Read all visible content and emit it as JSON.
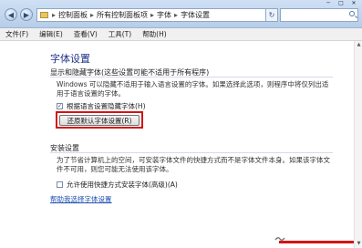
{
  "addressbar": {
    "segments": [
      "控制面板",
      "所有控制面板项",
      "字体",
      "字体设置"
    ],
    "sep": "▸"
  },
  "menubar": {
    "items": [
      "文件(F)",
      "编辑(E)",
      "查看(V)",
      "工具(T)",
      "帮助(H)"
    ]
  },
  "page": {
    "title": "字体设置",
    "section1_heading": "显示和隐藏字体(这些设置可能不适用于所有程序)",
    "section1_desc": "Windows 可以隐藏不适用于输入语言设置的字体。如果选择此选项，则程序中将仅列出适用于语言设置的字体。",
    "hide_fonts_checkbox_label": "根据语言设置隐藏字体(H)",
    "hide_fonts_checked": true,
    "restore_button_label": "还原默认字体设置(R)",
    "section2_heading": "安装设置",
    "section2_desc": "为了节省计算机上的空间，可安装字体文件的快捷方式而不是字体文件本身。如果该字体文件不可用，则您可能无法使用该字体。",
    "shortcut_checkbox_label": "允许使用快捷方式安装字体(高级)(A)",
    "shortcut_checked": false,
    "help_link": "帮助我选择字体设置"
  },
  "colors": {
    "highlight": "#d41414",
    "title": "#1e3287",
    "link": "#1e4fb0"
  }
}
